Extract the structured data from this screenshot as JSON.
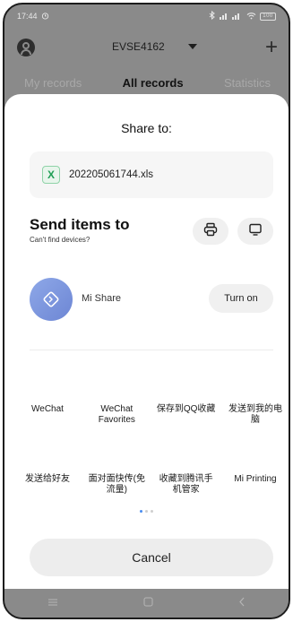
{
  "status_bar": {
    "time": "17:44",
    "signal_text": " ⁂ ⁂ll ..ll",
    "battery": "100"
  },
  "header": {
    "device": "EVSE4162"
  },
  "tabs": [
    {
      "label": "My records"
    },
    {
      "label": "All records"
    },
    {
      "label": "Statistics"
    }
  ],
  "sheet": {
    "title": "Share to:",
    "file_name": "202205061744.xls",
    "file_icon_letter": "X",
    "send_title": "Send items to",
    "send_subtitle": "Can't find devices?",
    "mi_share_label": "Mi Share",
    "turn_on_label": "Turn on",
    "apps_row1": [
      "WeChat",
      "WeChat Favorites",
      "保存到QQ收藏",
      "发送到我的电脑"
    ],
    "apps_row2": [
      "发送给好友",
      "面对面快传(免流量)",
      "收藏到腾讯手机管家",
      "Mi Printing"
    ],
    "cancel_label": "Cancel"
  },
  "colors": {
    "accent": "#4a8df0",
    "excel_green": "#1e9e54",
    "mi_share": "#7a93dd"
  },
  "icons": [
    "avatar-icon",
    "plus-icon",
    "excel-file-icon",
    "printer-icon",
    "screen-cast-icon",
    "mi-share-icon",
    "menu-icon",
    "home-icon",
    "back-icon"
  ]
}
